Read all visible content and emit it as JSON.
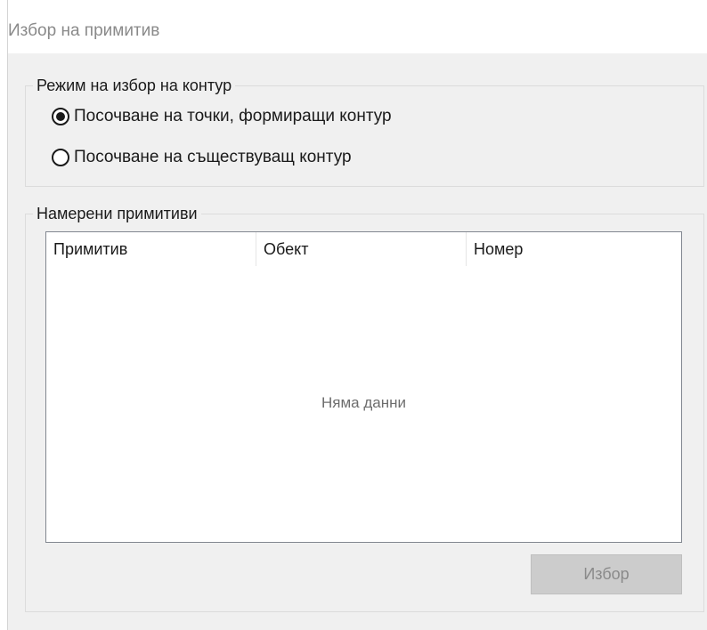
{
  "window": {
    "title": "Избор на примитив"
  },
  "mode_group": {
    "legend": "Режим на избор на контур",
    "options": [
      {
        "label": "Посочване на точки, формиращи контур",
        "selected": true
      },
      {
        "label": "Посочване на съществуващ контур",
        "selected": false
      }
    ]
  },
  "found_group": {
    "legend": "Намерени примитиви",
    "columns": [
      "Примитив",
      "Обект",
      "Номер"
    ],
    "rows": [],
    "empty_text": "Няма данни"
  },
  "buttons": {
    "select_label": "Избор",
    "select_enabled": false
  },
  "colors": {
    "window_bg": "#f0f0f0",
    "list_border": "#828790",
    "disabled_button_bg": "#cccccc",
    "disabled_text": "#8a8a8a"
  }
}
